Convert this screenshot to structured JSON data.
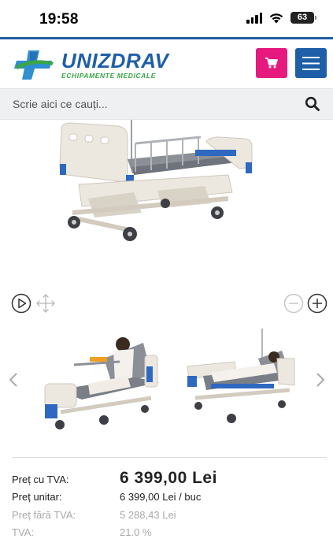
{
  "status_bar": {
    "time": "19:58",
    "battery": "63",
    "icons": [
      "signal-icon",
      "wifi-icon",
      "battery-icon"
    ]
  },
  "header": {
    "brand": "UNIZDRAV",
    "tagline": "ECHIPAMENTE MEDICALE",
    "icons": [
      "logo-cross-icon",
      "cart-icon",
      "hamburger-menu-icon"
    ],
    "colors": {
      "brand_blue": "#1e5fa8",
      "brand_green": "#3aa646",
      "cart_pink": "#e6197f",
      "top_rule": "#1f5e9c"
    }
  },
  "search": {
    "placeholder": "Scrie aici ce cauți...",
    "value": "",
    "icon": "search-icon"
  },
  "gallery": {
    "main_image": "hospital-bed-photo",
    "controls": [
      "play-icon",
      "expand-arrows-icon",
      "zoom-out-icon",
      "zoom-in-icon"
    ],
    "thumbnails": [
      "bed-with-patient-eating-thumbnail",
      "bed-with-patient-reclining-thumbnail"
    ],
    "arrows": [
      "chevron-left-icon",
      "chevron-right-icon"
    ]
  },
  "prices": {
    "price_with_vat_label": "Preț cu TVA:",
    "price_with_vat_value": "6 399,00 Lei",
    "unit_price_label": "Preț unitar:",
    "unit_price_value": "6 399,00 Lei / buc",
    "price_without_vat_label": "Preț fără TVA:",
    "price_without_vat_value": "5 288,43 Lei",
    "vat_label": "TVA:",
    "vat_value": "21.0 %"
  }
}
